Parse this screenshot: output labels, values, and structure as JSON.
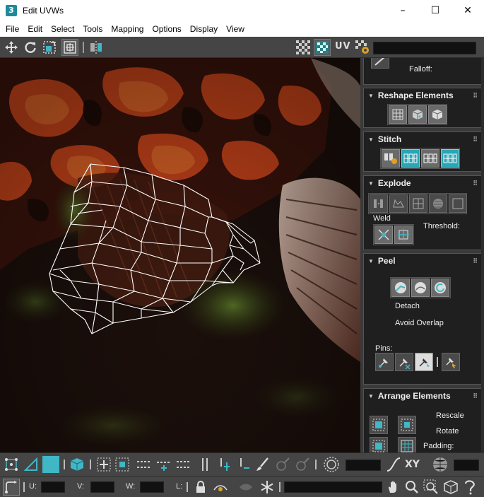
{
  "window": {
    "title": "Edit UVWs",
    "app_icon": "3",
    "minimize": "–",
    "maximize": "☐",
    "close": "✕"
  },
  "menu": [
    "File",
    "Edit",
    "Select",
    "Tools",
    "Mapping",
    "Options",
    "Display",
    "View"
  ],
  "toolbar": {
    "uv_label": "UV"
  },
  "panel": {
    "falloff_label": "Falloff:",
    "reshape": {
      "title": "Reshape Elements"
    },
    "stitch": {
      "title": "Stitch"
    },
    "explode": {
      "title": "Explode",
      "weld_label": "Weld",
      "threshold_label": "Threshold:"
    },
    "peel": {
      "title": "Peel",
      "detach_label": "Detach",
      "avoid_overlap_label": "Avoid Overlap",
      "pins_label": "Pins:"
    },
    "arrange": {
      "title": "Arrange Elements",
      "rescale_label": "Rescale",
      "rotate_label": "Rotate",
      "padding_label": "Padding:"
    }
  },
  "bottom": {
    "xy_label": "XY",
    "u_label": "U:",
    "v_label": "V:",
    "w_label": "W:",
    "l_label": "L:"
  },
  "colors": {
    "accent_teal": "#2aa6b5",
    "panel_bg": "#1f1f1f",
    "toolbar_bg": "#454545"
  }
}
